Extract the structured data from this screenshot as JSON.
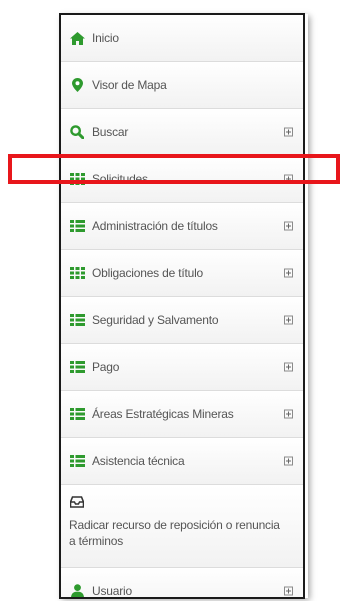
{
  "menu": {
    "items": [
      {
        "label": "Inicio",
        "icon": "home-icon",
        "expandable": false
      },
      {
        "label": "Visor de Mapa",
        "icon": "map-marker-icon",
        "expandable": false
      },
      {
        "label": "Buscar",
        "icon": "search-icon",
        "expandable": true
      },
      {
        "label": "Solicitudes",
        "icon": "grid-icon",
        "expandable": true
      },
      {
        "label": "Administración de títulos",
        "icon": "list-icon",
        "expandable": true
      },
      {
        "label": "Obligaciones de título",
        "icon": "grid-icon",
        "expandable": true
      },
      {
        "label": "Seguridad y Salvamento",
        "icon": "list-icon",
        "expandable": true
      },
      {
        "label": "Pago",
        "icon": "list-icon",
        "expandable": true
      },
      {
        "label": "Áreas Estratégicas Mineras",
        "icon": "list-icon",
        "expandable": true
      },
      {
        "label": "Asistencia técnica",
        "icon": "list-icon",
        "expandable": true
      },
      {
        "label": "Radicar recurso de reposición o renuncia a términos",
        "icon": "inbox-icon",
        "expandable": false
      },
      {
        "label": "Usuario",
        "icon": "user-icon",
        "expandable": true
      }
    ]
  },
  "colors": {
    "icon_green": "#2e9a2e",
    "text": "#555555",
    "highlight_red": "#e8161b",
    "panel_border": "#1a1a1a"
  },
  "highlighted_item": "Solicitudes"
}
